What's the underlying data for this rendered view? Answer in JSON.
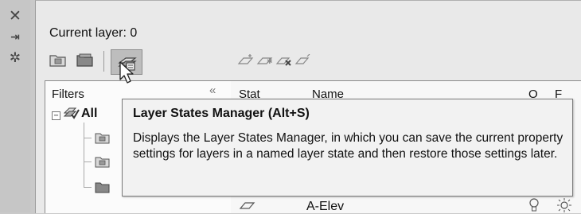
{
  "palette": {
    "current_layer_label": "Current layer: 0"
  },
  "filters": {
    "header": "Filters",
    "tree": {
      "root_label": "All"
    }
  },
  "layer_list": {
    "columns": [
      "Stat",
      "Name",
      "O",
      "F"
    ],
    "visible_row": {
      "name": "A-Elev"
    }
  },
  "tooltip": {
    "title": "Layer States Manager (Alt+S)",
    "description": "Displays the Layer States Manager, in which you can save the current property settings for layers in a named layer state and then restore those settings later."
  },
  "icons": {
    "close": "close-icon",
    "autohide": "auto-hide-icon",
    "properties": "properties-gear-icon",
    "new_filter": "new-property-filter-icon",
    "new_group": "new-group-filter-icon",
    "layer_states": "layer-states-manager-icon",
    "new_layer": "new-layer-icon",
    "new_layer_vp": "new-layer-vp-frozen-icon",
    "delete_layer": "delete-layer-icon",
    "set_current": "set-current-icon"
  }
}
